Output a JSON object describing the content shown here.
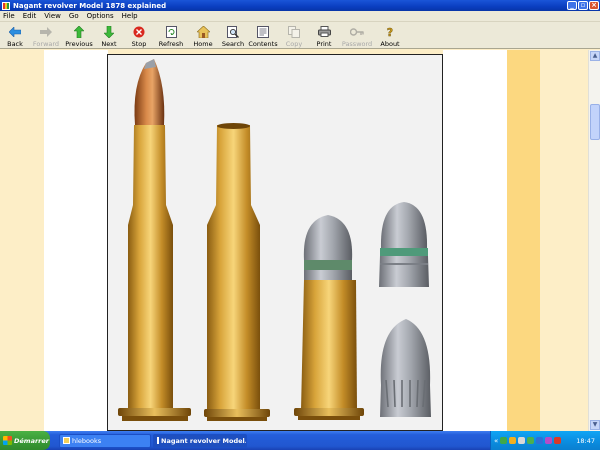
{
  "window": {
    "title": "Nagant revolver Model 1878 explained"
  },
  "menu": [
    "File",
    "Edit",
    "View",
    "Go",
    "Options",
    "Help"
  ],
  "toolbar": [
    {
      "label": "Back",
      "icon": "back-arrow-icon",
      "enabled": true
    },
    {
      "label": "Forward",
      "icon": "forward-arrow-icon",
      "enabled": false
    },
    {
      "label": "Previous",
      "icon": "up-arrow-icon",
      "enabled": true
    },
    {
      "label": "Next",
      "icon": "down-arrow-icon",
      "enabled": true
    },
    {
      "label": "Stop",
      "icon": "stop-icon",
      "enabled": true
    },
    {
      "label": "Refresh",
      "icon": "refresh-icon",
      "enabled": true
    },
    {
      "label": "Home",
      "icon": "home-icon",
      "enabled": true
    },
    {
      "label": "Search",
      "icon": "search-icon",
      "enabled": true
    },
    {
      "label": "Contents",
      "icon": "contents-icon",
      "enabled": true
    },
    {
      "label": "Copy",
      "icon": "copy-icon",
      "enabled": false
    },
    {
      "label": "Print",
      "icon": "print-icon",
      "enabled": true
    },
    {
      "label": "Password",
      "icon": "key-icon",
      "enabled": false
    },
    {
      "label": "About",
      "icon": "about-icon",
      "enabled": true
    }
  ],
  "taskbar": {
    "start_label": "Démarrer",
    "tasks": [
      {
        "label": "hlebooks",
        "icon": "folder-icon",
        "active": false
      },
      {
        "label": "Nagant revolver Model...",
        "icon": "ebook-app-icon",
        "active": true
      }
    ],
    "clock": "18:47"
  },
  "colors": {
    "page_background": "#fdeec7",
    "accent_band": "#fcd880",
    "titlebar": "#0a3ec0"
  }
}
